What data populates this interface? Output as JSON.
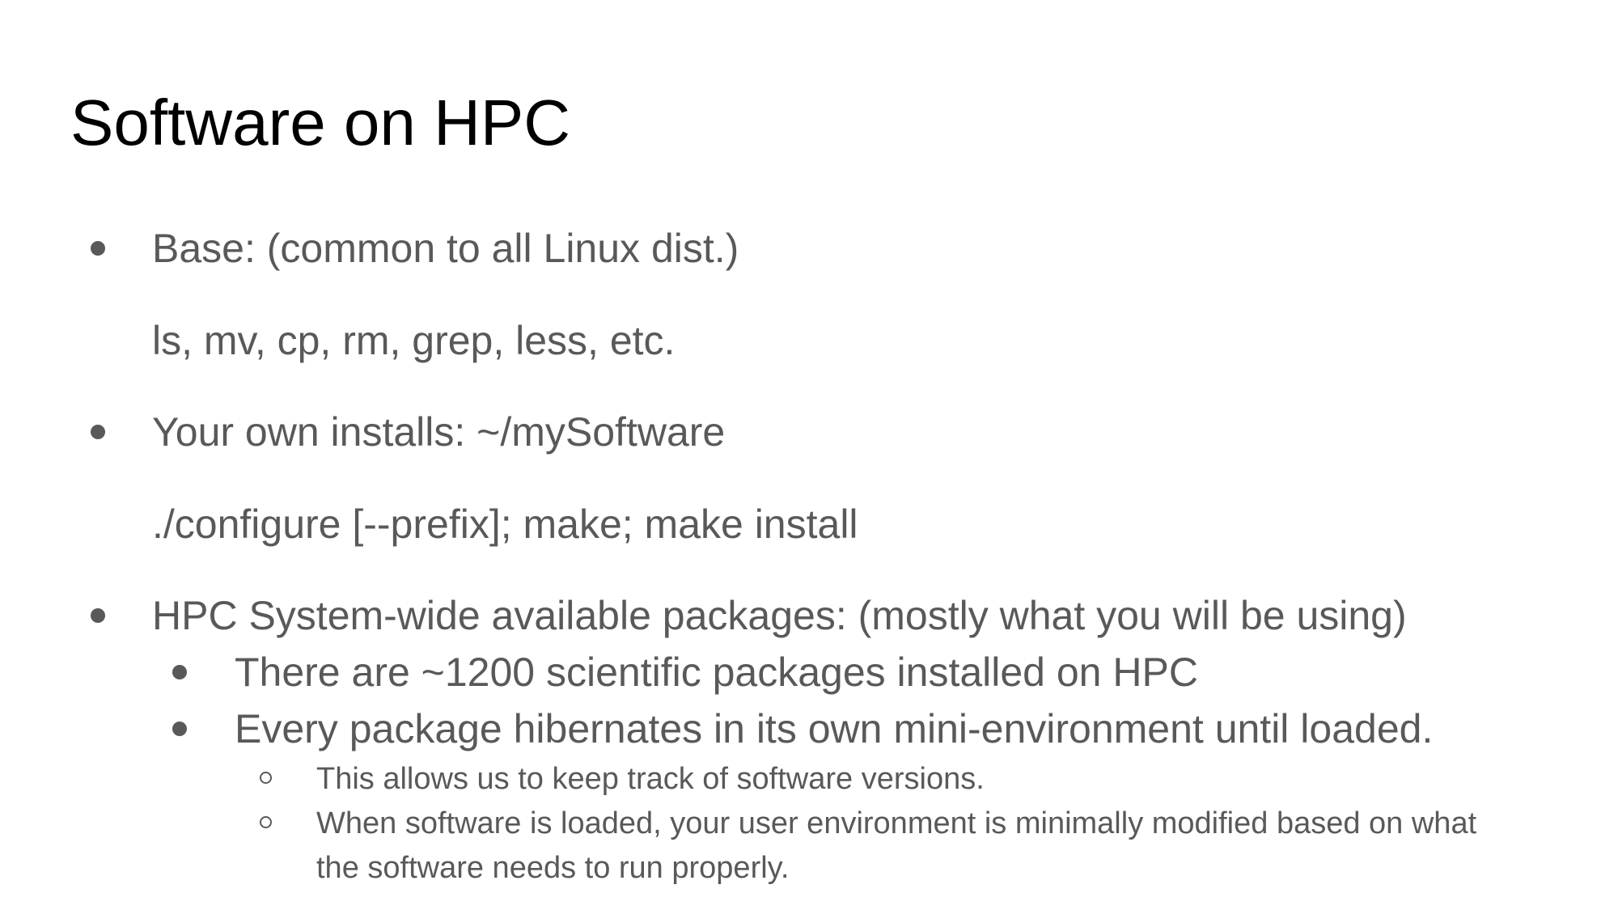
{
  "slide": {
    "title": "Software on HPC",
    "items": [
      {
        "text": "Base: (common to all Linux dist.)"
      },
      {
        "text": "ls, mv, cp, rm, grep, less, etc."
      },
      {
        "text": "Your own installs: ~/mySoftware"
      },
      {
        "text": "./configure [--prefix]; make; make install"
      },
      {
        "text": "HPC System-wide available packages: (mostly what you will be using)"
      },
      {
        "text": "There are ~1200 scientific packages installed on HPC"
      },
      {
        "text": "Every package hibernates in its own mini-environment until loaded."
      },
      {
        "text": "This allows us to keep track of software versions."
      },
      {
        "text": "When software is loaded, your user environment is minimally modified based on what"
      },
      {
        "text": "the software needs to run properly."
      }
    ]
  }
}
